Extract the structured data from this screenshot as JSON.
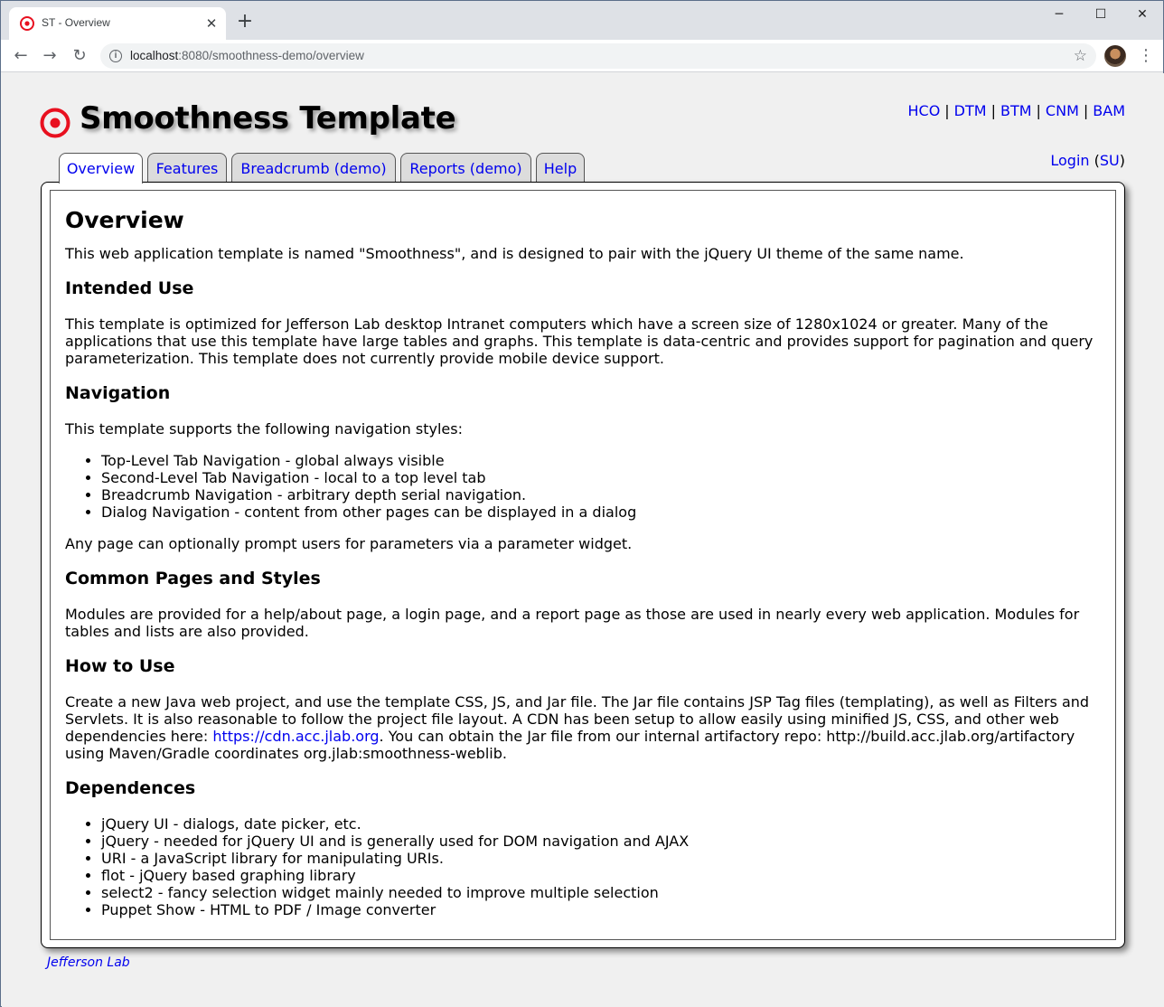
{
  "browser": {
    "tab_title": "ST - Overview",
    "url_host": "localhost",
    "url_rest": ":8080/smoothness-demo/overview"
  },
  "app": {
    "title": "Smoothness Template",
    "logo_color": "#e8101f"
  },
  "quick_links": [
    "HCO",
    "DTM",
    "BTM",
    "CNM",
    "BAM"
  ],
  "user": {
    "login_label": "Login",
    "su_label": "SU"
  },
  "nav_tabs": [
    {
      "label": "Overview",
      "active": true
    },
    {
      "label": "Features",
      "active": false
    },
    {
      "label": "Breadcrumb (demo)",
      "active": false
    },
    {
      "label": "Reports (demo)",
      "active": false
    },
    {
      "label": "Help",
      "active": false
    }
  ],
  "content": {
    "heading": "Overview",
    "intro": "This web application template is named \"Smoothness\", and is designed to pair with the jQuery UI theme of the same name.",
    "intended_use": {
      "heading": "Intended Use",
      "text": "This template is optimized for Jefferson Lab desktop Intranet computers which have a screen size of 1280x1024 or greater. Many of the applications that use this template have large tables and graphs. This template is data-centric and provides support for pagination and query parameterization. This template does not currently provide mobile device support."
    },
    "navigation": {
      "heading": "Navigation",
      "text": "This template supports the following navigation styles:",
      "items": [
        "Top-Level Tab Navigation - global always visible",
        "Second-Level Tab Navigation - local to a top level tab",
        "Breadcrumb Navigation - arbitrary depth serial navigation.",
        "Dialog Navigation - content from other pages can be displayed in a dialog"
      ],
      "after": "Any page can optionally prompt users for parameters via a parameter widget."
    },
    "common_pages": {
      "heading": "Common Pages and Styles",
      "text": "Modules are provided for a help/about page, a login page, and a report page as those are used in nearly every web application. Modules for tables and lists are also provided."
    },
    "how_to_use": {
      "heading": "How to Use",
      "text_before": "Create a new Java web project, and use the template CSS, JS, and Jar file. The Jar file contains JSP Tag files (templating), as well as Filters and Servlets. It is also reasonable to follow the project file layout. A CDN has been setup to allow easily using minified JS, CSS, and other web dependencies here: ",
      "link": "https://cdn.acc.jlab.org",
      "text_after": ". You can obtain the Jar file from our internal artifactory repo: http://build.acc.jlab.org/artifactory using Maven/Gradle coordinates org.jlab:smoothness-weblib."
    },
    "dependences": {
      "heading": "Dependences",
      "items": [
        "jQuery UI - dialogs, date picker, etc.",
        "jQuery - needed for jQuery UI and is generally used for DOM navigation and AJAX",
        "URI - a JavaScript library for manipulating URIs.",
        "flot - jQuery based graphing library",
        "select2 - fancy selection widget mainly needed to improve multiple selection",
        "Puppet Show - HTML to PDF / Image converter"
      ]
    }
  },
  "footer": {
    "link": "Jefferson Lab"
  }
}
